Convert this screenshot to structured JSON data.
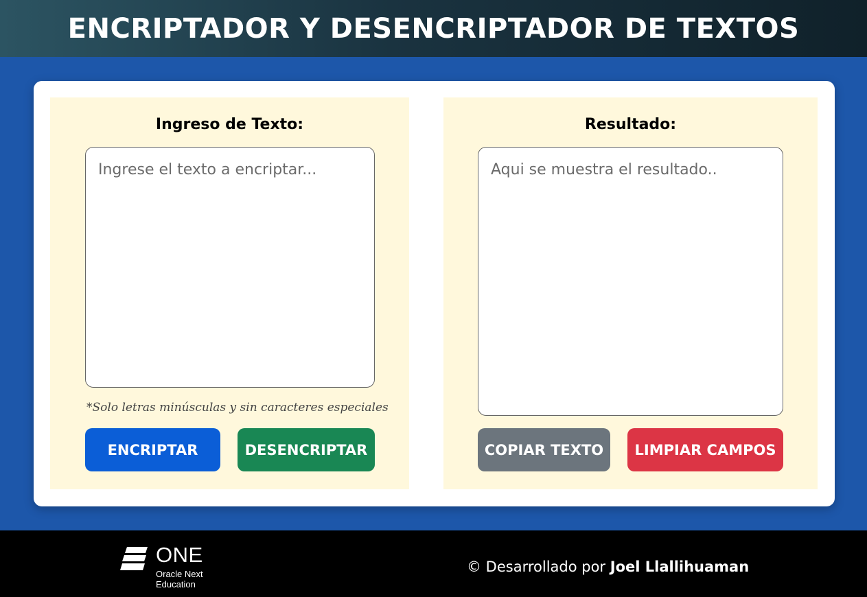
{
  "header": {
    "title": "ENCRIPTADOR Y DESENCRIPTADOR DE TEXTOS"
  },
  "input_panel": {
    "title": "Ingreso de Texto:",
    "textarea_value": "",
    "textarea_placeholder": "Ingrese el texto a encriptar...",
    "note": "*Solo letras minúsculas y sin caracteres especiales",
    "encrypt_label": "ENCRIPTAR",
    "decrypt_label": "DESENCRIPTAR"
  },
  "result_panel": {
    "title": "Resultado:",
    "textarea_value": "",
    "textarea_placeholder": "Aqui se muestra el resultado..",
    "copy_label": "COPIAR TEXTO",
    "clear_label": "LIMPIAR CAMPOS"
  },
  "footer": {
    "logo_text": "ONE",
    "logo_subtitle_line1": "Oracle Next",
    "logo_subtitle_line2": "Education",
    "logo_icon": "one-logo-icon",
    "credit_prefix": "© Desarrollado por ",
    "credit_author": "Joel Llallihuaman"
  },
  "colors": {
    "page_background": "#1d57aa",
    "panel_background": "#fff8dc",
    "encrypt_button": "#0b5ed7",
    "decrypt_button": "#198754",
    "copy_button": "#6c757d",
    "clear_button": "#dc3545",
    "footer_background": "#000000"
  }
}
